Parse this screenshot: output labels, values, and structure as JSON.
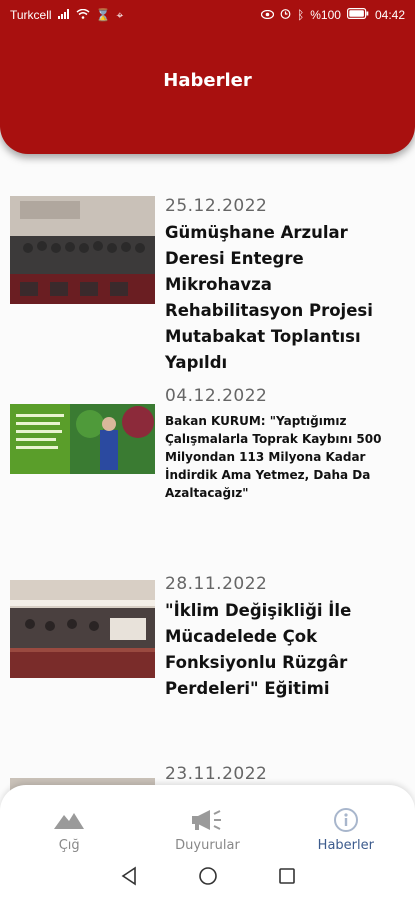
{
  "status_bar": {
    "carrier": "Turkcell",
    "battery": "%100",
    "time": "04:42"
  },
  "header": {
    "title": "Haberler"
  },
  "news": [
    {
      "date": "25.12.2022",
      "title": "Gümüşhane Arzular Deresi Entegre Mikrohavza Rehabilitasyon Projesi Mutabakat Toplantısı Yapıldı"
    },
    {
      "date": "04.12.2022",
      "title": "Bakan KURUM: \"Yaptığımız Çalışmalarla Toprak Kaybını 500 Milyondan 113 Milyona Kadar İndirdik Ama Yetmez, Daha Da Azaltacağız\""
    },
    {
      "date": "28.11.2022",
      "title": "\"İklim Değişikliği İle Mücadelede Çok Fonksiyonlu Rüzgâr Perdeleri\" Eğitimi"
    },
    {
      "date": "23.11.2022",
      "title": ""
    }
  ],
  "bottom_nav": {
    "tabs": [
      {
        "label": "Çığ",
        "icon": "mountain-icon"
      },
      {
        "label": "Duyurular",
        "icon": "megaphone-icon"
      },
      {
        "label": "Haberler",
        "icon": "info-icon",
        "active": true
      }
    ]
  },
  "colors": {
    "primary": "#a8100f",
    "active_tab": "#3c5b8d"
  }
}
